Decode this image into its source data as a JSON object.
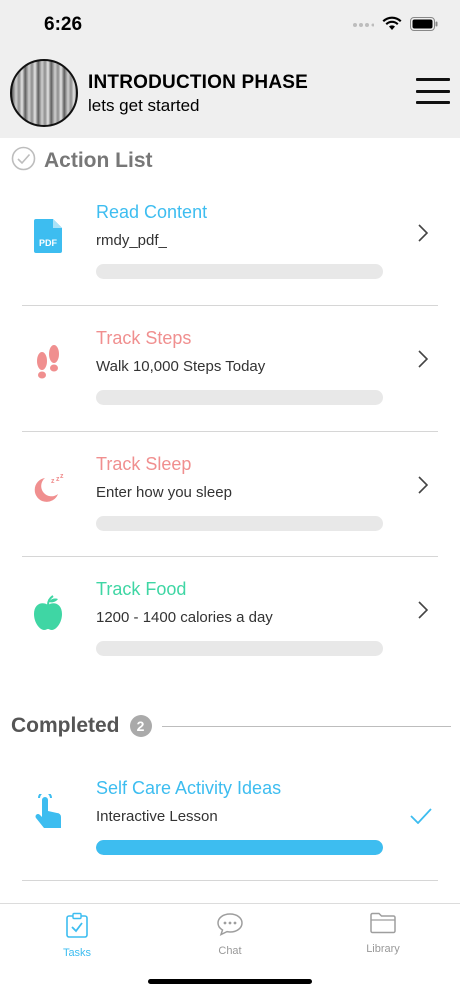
{
  "status": {
    "time": "6:26"
  },
  "header": {
    "title": "INTRODUCTION PHASE",
    "subtitle": "lets get started"
  },
  "action_list": {
    "title": "Action List",
    "items": [
      {
        "title": "Read Content",
        "subtitle": "rmdy_pdf_",
        "title_color": "#3dbdf0",
        "icon": "pdf-icon",
        "progress": 0
      },
      {
        "title": "Track Steps",
        "subtitle": "Walk 10,000 Steps Today",
        "title_color": "#f08f8f",
        "icon": "footprints-icon",
        "progress": 0
      },
      {
        "title": "Track Sleep",
        "subtitle": "Enter how you sleep",
        "title_color": "#f08f8f",
        "icon": "sleep-moon-icon",
        "progress": 0
      },
      {
        "title": "Track Food",
        "subtitle": "1200 - 1400 calories a day",
        "title_color": "#3fd6a4",
        "icon": "apple-icon",
        "progress": 0
      }
    ]
  },
  "completed": {
    "title": "Completed",
    "count": "2",
    "items": [
      {
        "title": "Self Care Activity Ideas",
        "subtitle": "Interactive Lesson",
        "title_color": "#3dbdf0",
        "icon": "tap-hand-icon",
        "progress": 1
      }
    ]
  },
  "tabs": [
    {
      "label": "Tasks",
      "icon": "tasks-icon",
      "active": true
    },
    {
      "label": "Chat",
      "icon": "chat-icon",
      "active": false
    },
    {
      "label": "Library",
      "icon": "folder-icon",
      "active": false
    }
  ],
  "colors": {
    "accent": "#3dbdf0",
    "coral": "#f08f8f",
    "mint": "#3fd6a4",
    "header_bg": "#efefef"
  }
}
